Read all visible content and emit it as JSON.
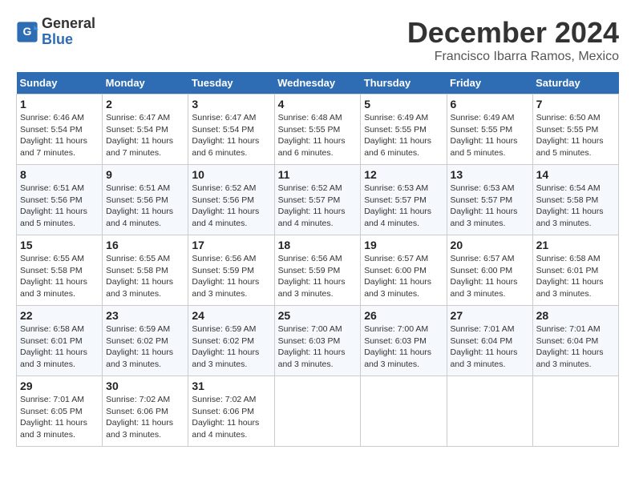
{
  "header": {
    "logo_line1": "General",
    "logo_line2": "Blue",
    "month_title": "December 2024",
    "location": "Francisco Ibarra Ramos, Mexico"
  },
  "weekdays": [
    "Sunday",
    "Monday",
    "Tuesday",
    "Wednesday",
    "Thursday",
    "Friday",
    "Saturday"
  ],
  "weeks": [
    [
      {
        "day": "1",
        "sunrise": "Sunrise: 6:46 AM",
        "sunset": "Sunset: 5:54 PM",
        "daylight": "Daylight: 11 hours and 7 minutes."
      },
      {
        "day": "2",
        "sunrise": "Sunrise: 6:47 AM",
        "sunset": "Sunset: 5:54 PM",
        "daylight": "Daylight: 11 hours and 7 minutes."
      },
      {
        "day": "3",
        "sunrise": "Sunrise: 6:47 AM",
        "sunset": "Sunset: 5:54 PM",
        "daylight": "Daylight: 11 hours and 6 minutes."
      },
      {
        "day": "4",
        "sunrise": "Sunrise: 6:48 AM",
        "sunset": "Sunset: 5:55 PM",
        "daylight": "Daylight: 11 hours and 6 minutes."
      },
      {
        "day": "5",
        "sunrise": "Sunrise: 6:49 AM",
        "sunset": "Sunset: 5:55 PM",
        "daylight": "Daylight: 11 hours and 6 minutes."
      },
      {
        "day": "6",
        "sunrise": "Sunrise: 6:49 AM",
        "sunset": "Sunset: 5:55 PM",
        "daylight": "Daylight: 11 hours and 5 minutes."
      },
      {
        "day": "7",
        "sunrise": "Sunrise: 6:50 AM",
        "sunset": "Sunset: 5:55 PM",
        "daylight": "Daylight: 11 hours and 5 minutes."
      }
    ],
    [
      {
        "day": "8",
        "sunrise": "Sunrise: 6:51 AM",
        "sunset": "Sunset: 5:56 PM",
        "daylight": "Daylight: 11 hours and 5 minutes."
      },
      {
        "day": "9",
        "sunrise": "Sunrise: 6:51 AM",
        "sunset": "Sunset: 5:56 PM",
        "daylight": "Daylight: 11 hours and 4 minutes."
      },
      {
        "day": "10",
        "sunrise": "Sunrise: 6:52 AM",
        "sunset": "Sunset: 5:56 PM",
        "daylight": "Daylight: 11 hours and 4 minutes."
      },
      {
        "day": "11",
        "sunrise": "Sunrise: 6:52 AM",
        "sunset": "Sunset: 5:57 PM",
        "daylight": "Daylight: 11 hours and 4 minutes."
      },
      {
        "day": "12",
        "sunrise": "Sunrise: 6:53 AM",
        "sunset": "Sunset: 5:57 PM",
        "daylight": "Daylight: 11 hours and 4 minutes."
      },
      {
        "day": "13",
        "sunrise": "Sunrise: 6:53 AM",
        "sunset": "Sunset: 5:57 PM",
        "daylight": "Daylight: 11 hours and 3 minutes."
      },
      {
        "day": "14",
        "sunrise": "Sunrise: 6:54 AM",
        "sunset": "Sunset: 5:58 PM",
        "daylight": "Daylight: 11 hours and 3 minutes."
      }
    ],
    [
      {
        "day": "15",
        "sunrise": "Sunrise: 6:55 AM",
        "sunset": "Sunset: 5:58 PM",
        "daylight": "Daylight: 11 hours and 3 minutes."
      },
      {
        "day": "16",
        "sunrise": "Sunrise: 6:55 AM",
        "sunset": "Sunset: 5:58 PM",
        "daylight": "Daylight: 11 hours and 3 minutes."
      },
      {
        "day": "17",
        "sunrise": "Sunrise: 6:56 AM",
        "sunset": "Sunset: 5:59 PM",
        "daylight": "Daylight: 11 hours and 3 minutes."
      },
      {
        "day": "18",
        "sunrise": "Sunrise: 6:56 AM",
        "sunset": "Sunset: 5:59 PM",
        "daylight": "Daylight: 11 hours and 3 minutes."
      },
      {
        "day": "19",
        "sunrise": "Sunrise: 6:57 AM",
        "sunset": "Sunset: 6:00 PM",
        "daylight": "Daylight: 11 hours and 3 minutes."
      },
      {
        "day": "20",
        "sunrise": "Sunrise: 6:57 AM",
        "sunset": "Sunset: 6:00 PM",
        "daylight": "Daylight: 11 hours and 3 minutes."
      },
      {
        "day": "21",
        "sunrise": "Sunrise: 6:58 AM",
        "sunset": "Sunset: 6:01 PM",
        "daylight": "Daylight: 11 hours and 3 minutes."
      }
    ],
    [
      {
        "day": "22",
        "sunrise": "Sunrise: 6:58 AM",
        "sunset": "Sunset: 6:01 PM",
        "daylight": "Daylight: 11 hours and 3 minutes."
      },
      {
        "day": "23",
        "sunrise": "Sunrise: 6:59 AM",
        "sunset": "Sunset: 6:02 PM",
        "daylight": "Daylight: 11 hours and 3 minutes."
      },
      {
        "day": "24",
        "sunrise": "Sunrise: 6:59 AM",
        "sunset": "Sunset: 6:02 PM",
        "daylight": "Daylight: 11 hours and 3 minutes."
      },
      {
        "day": "25",
        "sunrise": "Sunrise: 7:00 AM",
        "sunset": "Sunset: 6:03 PM",
        "daylight": "Daylight: 11 hours and 3 minutes."
      },
      {
        "day": "26",
        "sunrise": "Sunrise: 7:00 AM",
        "sunset": "Sunset: 6:03 PM",
        "daylight": "Daylight: 11 hours and 3 minutes."
      },
      {
        "day": "27",
        "sunrise": "Sunrise: 7:01 AM",
        "sunset": "Sunset: 6:04 PM",
        "daylight": "Daylight: 11 hours and 3 minutes."
      },
      {
        "day": "28",
        "sunrise": "Sunrise: 7:01 AM",
        "sunset": "Sunset: 6:04 PM",
        "daylight": "Daylight: 11 hours and 3 minutes."
      }
    ],
    [
      {
        "day": "29",
        "sunrise": "Sunrise: 7:01 AM",
        "sunset": "Sunset: 6:05 PM",
        "daylight": "Daylight: 11 hours and 3 minutes."
      },
      {
        "day": "30",
        "sunrise": "Sunrise: 7:02 AM",
        "sunset": "Sunset: 6:06 PM",
        "daylight": "Daylight: 11 hours and 3 minutes."
      },
      {
        "day": "31",
        "sunrise": "Sunrise: 7:02 AM",
        "sunset": "Sunset: 6:06 PM",
        "daylight": "Daylight: 11 hours and 4 minutes."
      },
      null,
      null,
      null,
      null
    ]
  ]
}
